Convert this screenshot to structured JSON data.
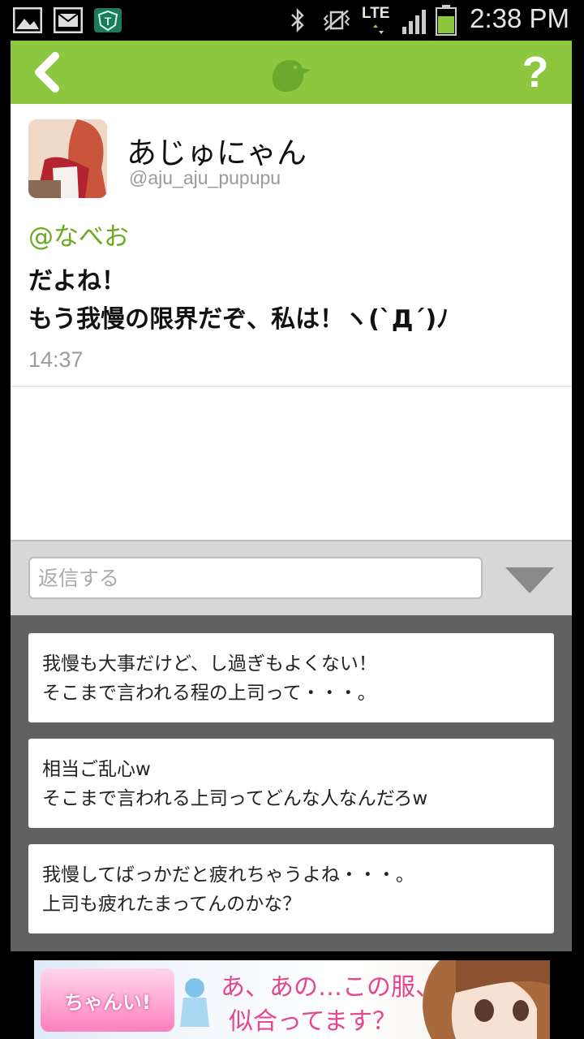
{
  "status_bar": {
    "time": "2:38 PM",
    "network": "LTE",
    "left_icons": [
      "image-icon",
      "mail-icon",
      "shield-t-icon"
    ],
    "right_icons": [
      "bluetooth-icon",
      "vibrate-icon",
      "signal-icon",
      "battery-icon"
    ]
  },
  "header": {
    "accent_color": "#8dc63f",
    "back_icon": "chevron-left-icon",
    "logo_icon": "bird-icon",
    "help_label": "?"
  },
  "tweet": {
    "display_name": "あじゅにゃん",
    "handle": "@aju_aju_pupupu",
    "mention": "@なべお",
    "lines": [
      "だよね！",
      "もう我慢の限界だぞ、私は！ヽ(`Д´)ﾉ"
    ],
    "time": "14:37"
  },
  "reply": {
    "placeholder": "返信する",
    "toggle_icon": "triangle-down-icon"
  },
  "suggestions": [
    {
      "line1": "我慢も大事だけど、し過ぎもよくない！",
      "line2": "そこまで言われる程の上司って・・・。"
    },
    {
      "line1": "相当ご乱心w",
      "line2": "そこまで言われる上司ってどんな人なんだろw"
    },
    {
      "line1": "我慢してばっかだと疲れちゃうよね・・・。",
      "line2": "上司も疲れたまってんのかな？"
    }
  ],
  "ad": {
    "logo_text": "ちゃんい!",
    "copy_line1": "あ、あの…この服、",
    "copy_line2": "似合ってます？"
  }
}
